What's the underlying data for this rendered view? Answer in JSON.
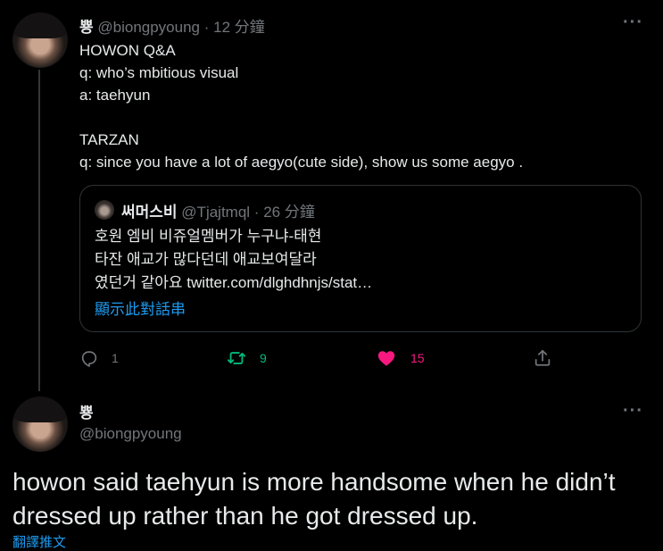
{
  "tweet1": {
    "name": "뿅",
    "handle": "@biongpyoung",
    "separator": "·",
    "time": "12 分鐘",
    "more": "···",
    "lines": [
      "HOWON Q&A",
      "q: who’s mbitious visual",
      "a: taehyun",
      "",
      "TARZAN",
      "q: since you have a lot of aegyo(cute side), show us some aegyo ."
    ],
    "quote": {
      "name": "써머스비",
      "handle": "@Tjajtmql",
      "separator": "·",
      "time": "26 分鐘",
      "lines": [
        "호원 엠비 비쥬얼멤버가 누구냐-태현",
        "타잔 애교가 많다던데 애교보여달라",
        "였던거 같아요 twitter.com/dlghdhnjs/stat…"
      ],
      "show_thread": "顯示此對話串"
    },
    "actions": {
      "reply_count": "1",
      "retweet_count": "9",
      "like_count": "15"
    }
  },
  "tweet2": {
    "name": "뿅",
    "handle": "@biongpyoung",
    "more": "···",
    "lines": [
      "howon said taehyun is more handsome when he didn’t",
      "dressed up rather than he got dressed up."
    ],
    "translate": "翻譯推文"
  },
  "colors": {
    "background": "#000000",
    "text": "#e7e9ea",
    "muted": "#71767b",
    "link": "#1d9bf0",
    "retweet": "#00ba7c",
    "like": "#f91880"
  }
}
